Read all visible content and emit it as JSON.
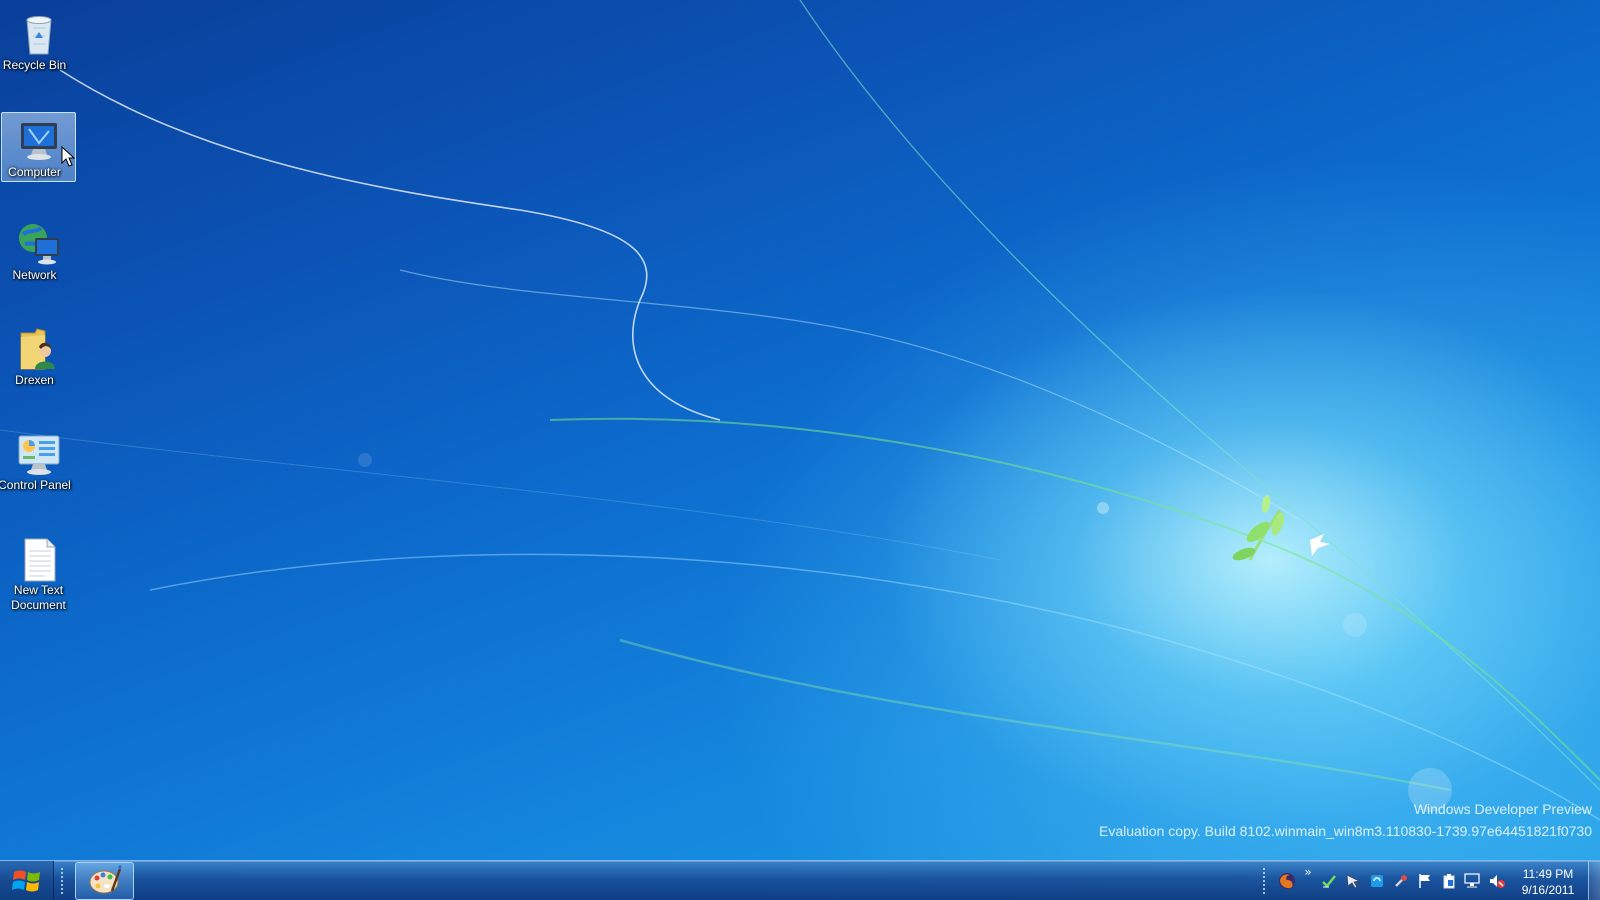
{
  "desktop": {
    "icons": [
      {
        "label": "Recycle Bin",
        "icon": "recycle-bin-icon",
        "selected": false
      },
      {
        "label": "Computer",
        "icon": "computer-icon",
        "selected": true
      },
      {
        "label": "Network",
        "icon": "network-icon",
        "selected": false
      },
      {
        "label": "Drexen",
        "icon": "user-folder-icon",
        "selected": false
      },
      {
        "label": "Control Panel",
        "icon": "control-panel-icon",
        "selected": false
      },
      {
        "label": "New Text Document",
        "icon": "text-document-icon",
        "selected": false
      }
    ]
  },
  "watermark": {
    "line1": "Windows Developer Preview",
    "line2": "Evaluation copy. Build 8102.winmain_win8m3.110830-1739.97e64451821f0730"
  },
  "taskbar": {
    "start_icon": "windows-logo-icon",
    "pinned_app_icon": "paint-palette-icon",
    "tray_expand": "»",
    "tray_icons": [
      "firefox-icon",
      "checkmark-icon",
      "pointer-icon",
      "sync-icon",
      "tools-icon",
      "action-center-flag-icon",
      "clipboard-icon",
      "network-monitor-icon",
      "volume-muted-icon"
    ],
    "clock": {
      "time": "11:49 PM",
      "date": "9/16/2011"
    }
  },
  "colors": {
    "wallpaper_dark": "#0a3f9a",
    "wallpaper_light": "#c8faff",
    "taskbar": "#174a92",
    "text": "#ffffff"
  }
}
